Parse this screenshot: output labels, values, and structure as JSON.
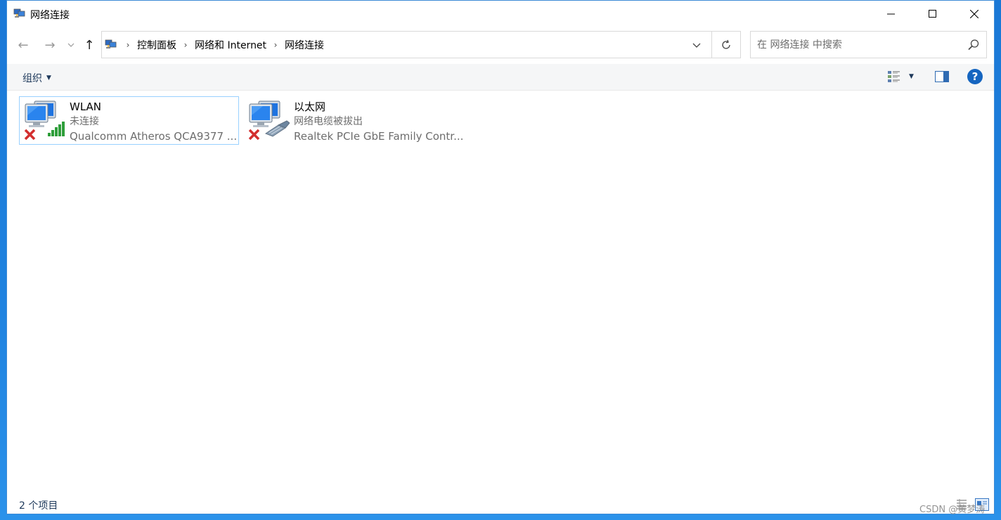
{
  "window": {
    "title": "网络连接",
    "minimize_label": "Minimize",
    "maximize_label": "Maximize",
    "close_label": "Close"
  },
  "address": {
    "breadcrumbs": [
      "控制面板",
      "网络和 Internet",
      "网络连接"
    ]
  },
  "search": {
    "placeholder": "在 网络连接 中搜索"
  },
  "commandbar": {
    "organize_label": "组织"
  },
  "connections": [
    {
      "name": "WLAN",
      "status": "未连接",
      "device": "Qualcomm Atheros QCA9377 ...",
      "icon": "wireless-network-disconnected-icon",
      "selected": true
    },
    {
      "name": "以太网",
      "status": "网络电缆被拔出",
      "device": "Realtek PCIe GbE Family Contr...",
      "icon": "ethernet-network-unplugged-icon",
      "selected": false
    }
  ],
  "statusbar": {
    "item_count": "2 个项目"
  },
  "watermark": "CSDN @黄梦涛",
  "colors": {
    "accent": "#1565c0",
    "selection_border": "#99d1ff",
    "desktop": "#1f83e0",
    "error_red": "#d32f2f",
    "signal_green": "#2e9e3a"
  }
}
